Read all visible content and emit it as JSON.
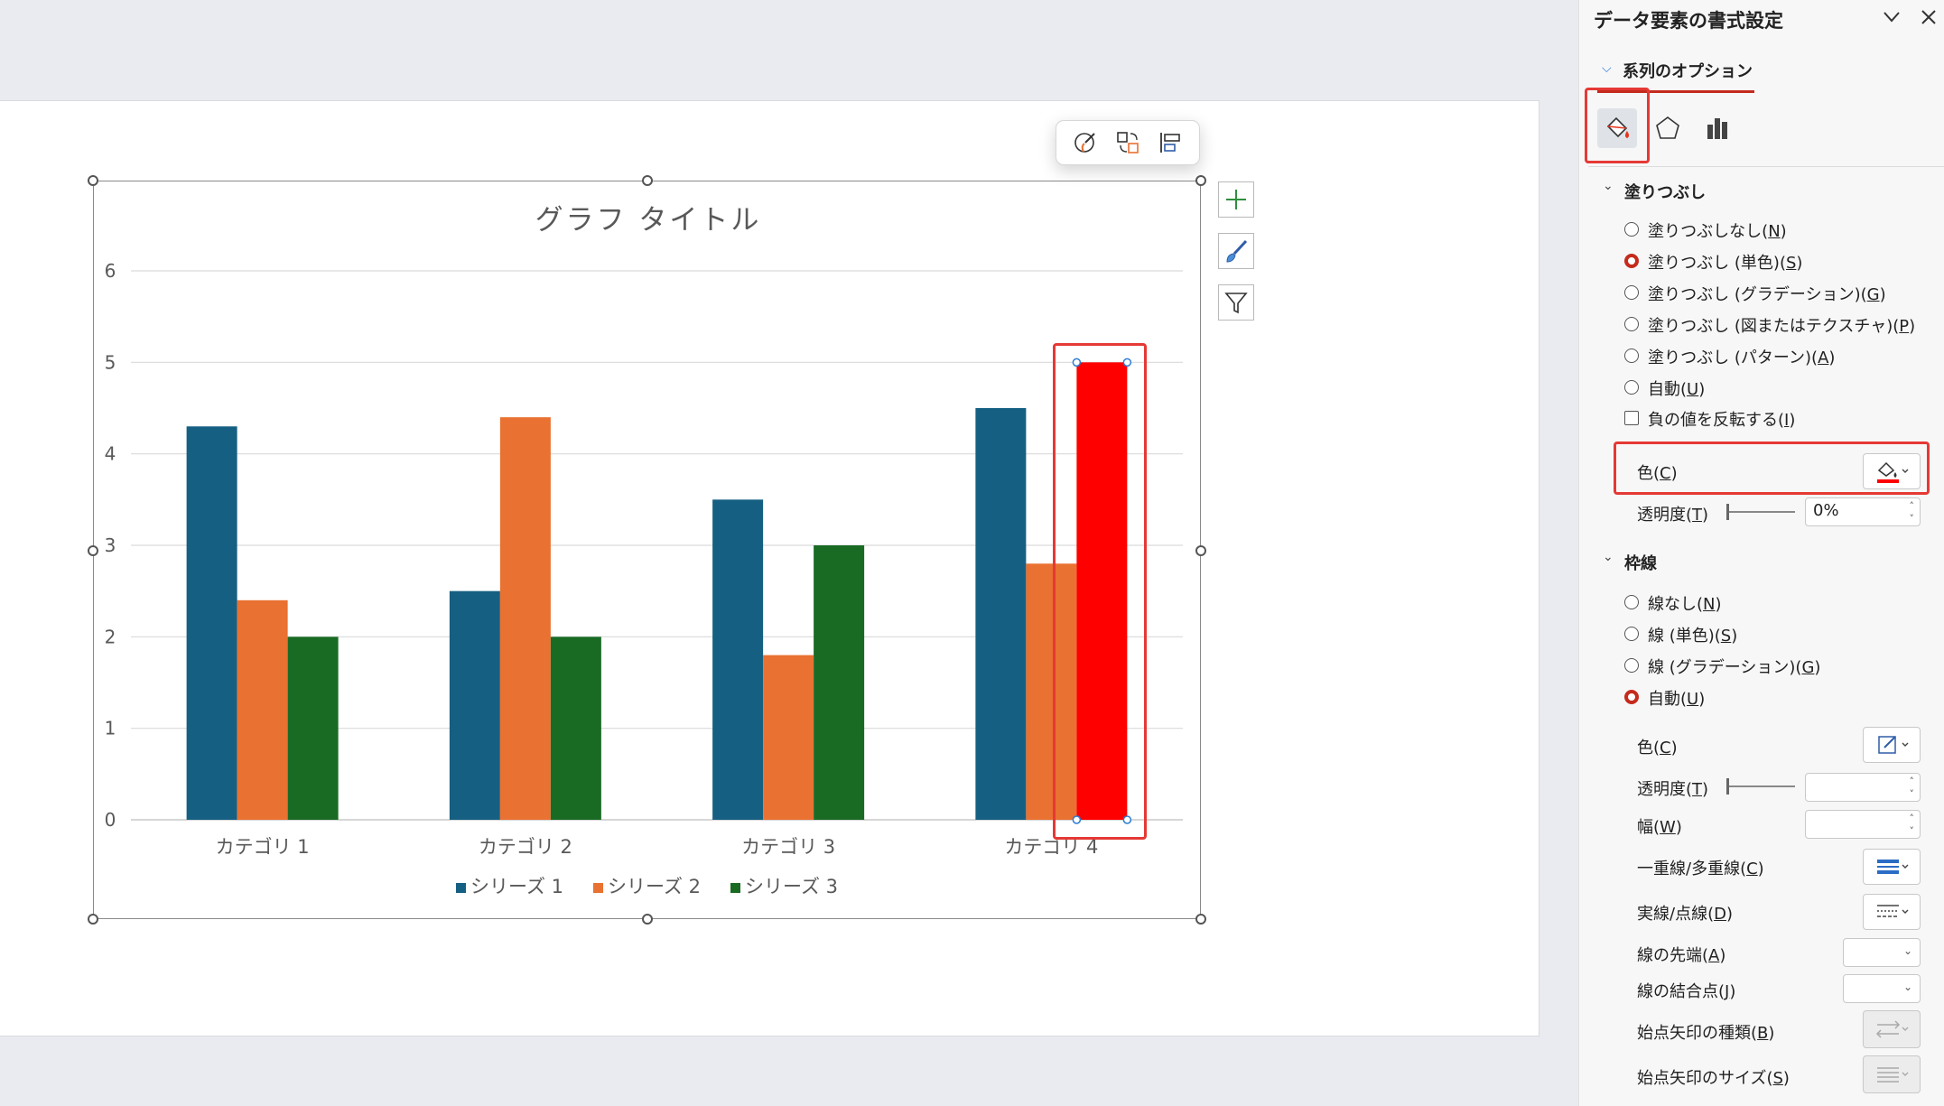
{
  "chart_data": {
    "type": "bar",
    "title": "グラフ タイトル",
    "categories": [
      "カテゴリ 1",
      "カテゴリ 2",
      "カテゴリ 3",
      "カテゴリ 4"
    ],
    "series": [
      {
        "name": "シリーズ 1",
        "values": [
          4.3,
          2.5,
          3.5,
          4.5
        ],
        "color": "#156082"
      },
      {
        "name": "シリーズ 2",
        "values": [
          2.4,
          4.4,
          1.8,
          2.8
        ],
        "color": "#e97132"
      },
      {
        "name": "シリーズ 3",
        "values": [
          2.0,
          2.0,
          3.0,
          5.0
        ],
        "color": "#196b24"
      }
    ],
    "highlight_point": {
      "series": "シリーズ 3",
      "category": "カテゴリ 4",
      "color": "#ff0000"
    },
    "y_ticks": [
      "0",
      "1",
      "2",
      "3",
      "4",
      "5",
      "6"
    ],
    "ylim": [
      0,
      6
    ],
    "grid": true,
    "legend_position": "bottom"
  },
  "chart_tools": {
    "add_element_icon": "plus-icon",
    "style_icon": "brush-icon",
    "filter_icon": "funnel-icon"
  },
  "mini_toolbar": {
    "icons": [
      "style-icon",
      "change-color-icon",
      "layout-icon"
    ]
  },
  "pane": {
    "title": "データ要素の書式設定",
    "title_chevron": "chevron-down-icon",
    "close_icon": "close-icon",
    "options_label": "系列のオプション",
    "tab_icons": [
      "fill-line-icon",
      "effects-icon",
      "series-options-icon"
    ],
    "fill": {
      "heading": "塗りつぶし",
      "options": [
        {
          "text": "塗りつぶしなし(",
          "key": "N",
          "selected": false
        },
        {
          "text": "塗りつぶし (単色)(",
          "key": "S",
          "selected": true
        },
        {
          "text": "塗りつぶし (グラデーション)(",
          "key": "G",
          "selected": false
        },
        {
          "text": "塗りつぶし (図またはテクスチャ)(",
          "key": "P",
          "selected": false
        },
        {
          "text": "塗りつぶし (パターン)(",
          "key": "A",
          "selected": false
        },
        {
          "text": "自動(",
          "key": "U",
          "selected": false
        }
      ],
      "invert_text": "負の値を反転する(",
      "invert_key": "I",
      "color_label": "色(",
      "color_key": "C",
      "color_value": "#ff0000",
      "transparency_label": "透明度(",
      "transparency_key": "T",
      "transparency_value": "0%"
    },
    "border": {
      "heading": "枠線",
      "options": [
        {
          "text": "線なし(",
          "key": "N",
          "selected": false
        },
        {
          "text": "線 (単色)(",
          "key": "S",
          "selected": false
        },
        {
          "text": "線 (グラデーション)(",
          "key": "G",
          "selected": false
        },
        {
          "text": "自動(",
          "key": "U",
          "selected": true
        }
      ],
      "color_label": "色(",
      "color_key": "C",
      "transparency_label": "透明度(",
      "transparency_key": "T",
      "width_label": "幅(",
      "width_key": "W",
      "compound_label": "一重線/多重線(",
      "compound_key": "C",
      "dash_label": "実線/点線(",
      "dash_key": "D",
      "cap_label": "線の先端(",
      "cap_key": "A",
      "join_label": "線の結合点(",
      "join_key": "J",
      "begin_arrow_type_label": "始点矢印の種類(",
      "begin_arrow_type_key": "B",
      "begin_arrow_size_label": "始点矢印のサイズ(",
      "begin_arrow_size_key": "S"
    }
  }
}
